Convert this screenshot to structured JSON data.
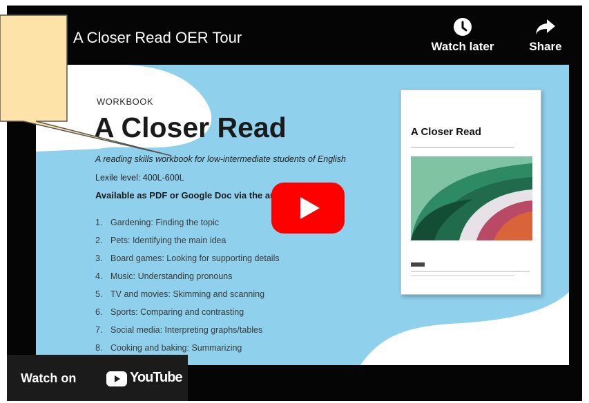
{
  "video": {
    "title": "A Closer Read OER Tour",
    "actions": [
      {
        "label": "Watch later",
        "icon": "clock-icon"
      },
      {
        "label": "Share",
        "icon": "share-arrow-icon"
      }
    ]
  },
  "slide": {
    "kicker": "WORKBOOK",
    "title": "A Closer Read",
    "subtitle": "A reading skills workbook for low-intermediate students of English",
    "lexile": "Lexile level: 400L-600L",
    "availability": "Available as PDF or Google Doc via the author",
    "contents": [
      {
        "num": "1.",
        "text": "Gardening: Finding the topic"
      },
      {
        "num": "2.",
        "text": "Pets: Identifying the main idea"
      },
      {
        "num": "3.",
        "text": "Board games: Looking for supporting details"
      },
      {
        "num": "4.",
        "text": "Music: Understanding pronouns"
      },
      {
        "num": "5.",
        "text": "TV and movies: Skimming and scanning"
      },
      {
        "num": "6.",
        "text": "Sports: Comparing and contrasting"
      },
      {
        "num": "7.",
        "text": "Social media: Interpreting graphs/tables"
      },
      {
        "num": "8.",
        "text": "Cooking and baking: Summarizing"
      }
    ],
    "book": {
      "title": "A Closer Read"
    }
  },
  "footer": {
    "watch_on": "Watch on",
    "youtube": "YouTube"
  },
  "colors": {
    "slide_blue": "#8fd0ec",
    "callout_fill": "#fde3a7",
    "play_red": "#ff0000",
    "player_black": "#050505"
  }
}
